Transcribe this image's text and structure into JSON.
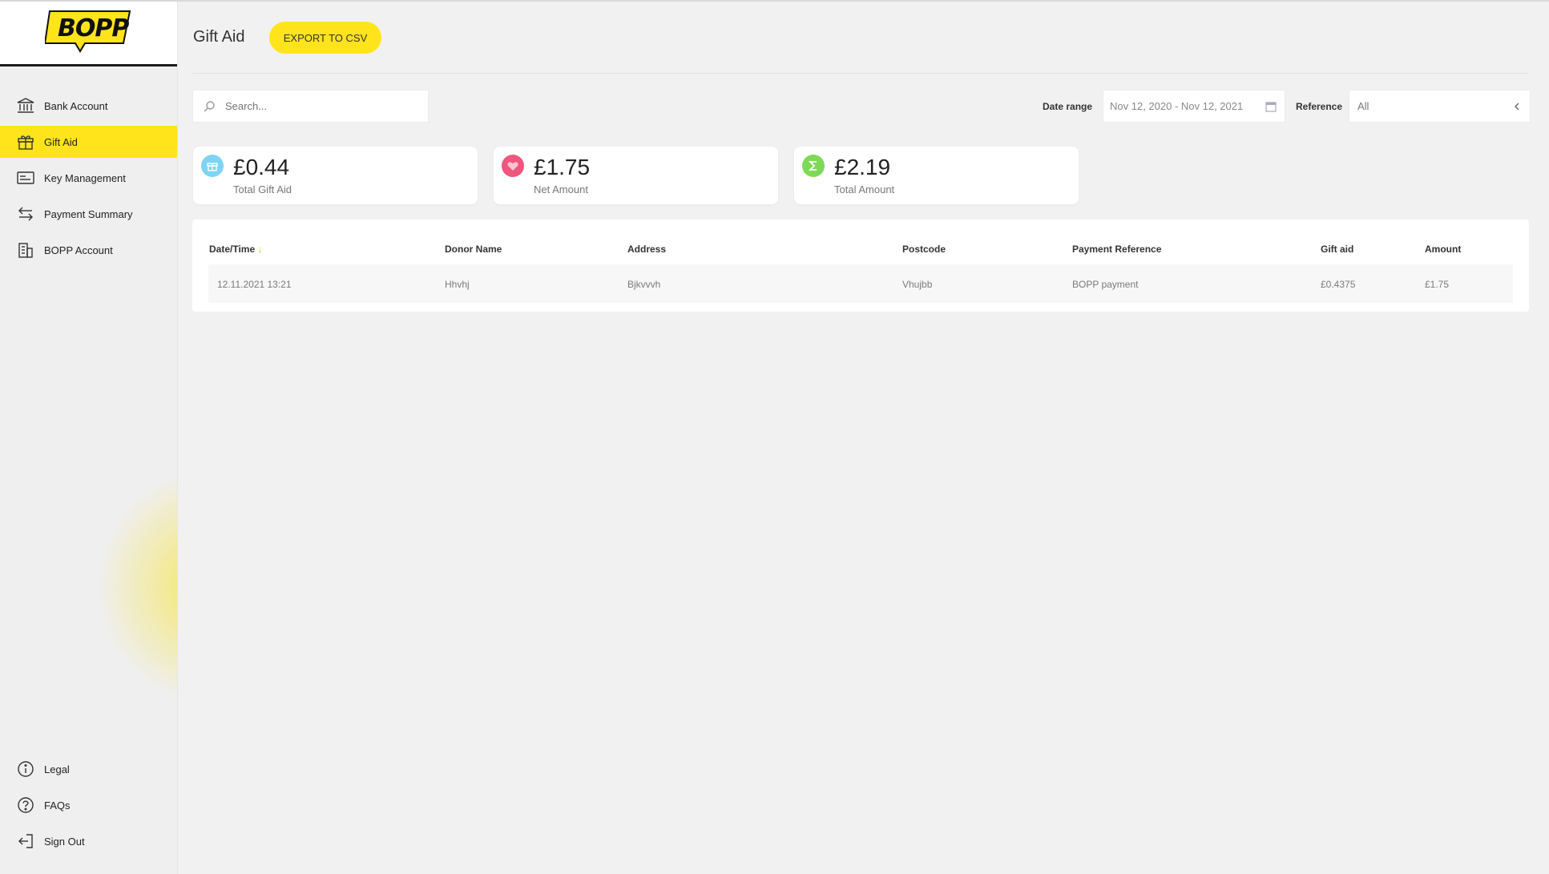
{
  "brand": {
    "logo_text": "BOPP",
    "accent": "#ffe41c"
  },
  "sidebar": {
    "items": [
      {
        "label": "Bank Account",
        "icon": "bank-icon",
        "active": false
      },
      {
        "label": "Gift Aid",
        "icon": "gift-icon",
        "active": true
      },
      {
        "label": "Key Management",
        "icon": "key-card-icon",
        "active": false
      },
      {
        "label": "Payment Summary",
        "icon": "transfer-arrows-icon",
        "active": false
      },
      {
        "label": "BOPP Account",
        "icon": "building-icon",
        "active": false
      }
    ],
    "bottom_items": [
      {
        "label": "Legal",
        "icon": "info-icon"
      },
      {
        "label": "FAQs",
        "icon": "question-icon"
      },
      {
        "label": "Sign Out",
        "icon": "sign-out-icon"
      }
    ]
  },
  "header": {
    "title": "Gift Aid",
    "export_label": "EXPORT TO CSV"
  },
  "filters": {
    "search_placeholder": "Search...",
    "date_range_label": "Date range",
    "date_range_value": "Nov 12, 2020 - Nov 12, 2021",
    "reference_label": "Reference",
    "reference_value": "All"
  },
  "stats": [
    {
      "value": "£0.44",
      "label": "Total Gift Aid",
      "icon": "gift-icon",
      "color": "#7fd3f5"
    },
    {
      "value": "£1.75",
      "label": "Net Amount",
      "icon": "heart-icon",
      "color": "#f0557e"
    },
    {
      "value": "£2.19",
      "label": "Total Amount",
      "icon": "sigma-icon",
      "color": "#7ed957"
    }
  ],
  "table": {
    "headers": [
      "Date/Time",
      "Donor Name",
      "Address",
      "Postcode",
      "Payment Reference",
      "Gift aid",
      "Amount"
    ],
    "sort_indicator": "↓",
    "rows": [
      [
        "12.11.2021 13:21",
        "Hhvhj",
        "Bjkvvvh",
        "Vhujbb",
        "BOPP payment",
        "£0.4375",
        "£1.75"
      ]
    ]
  }
}
